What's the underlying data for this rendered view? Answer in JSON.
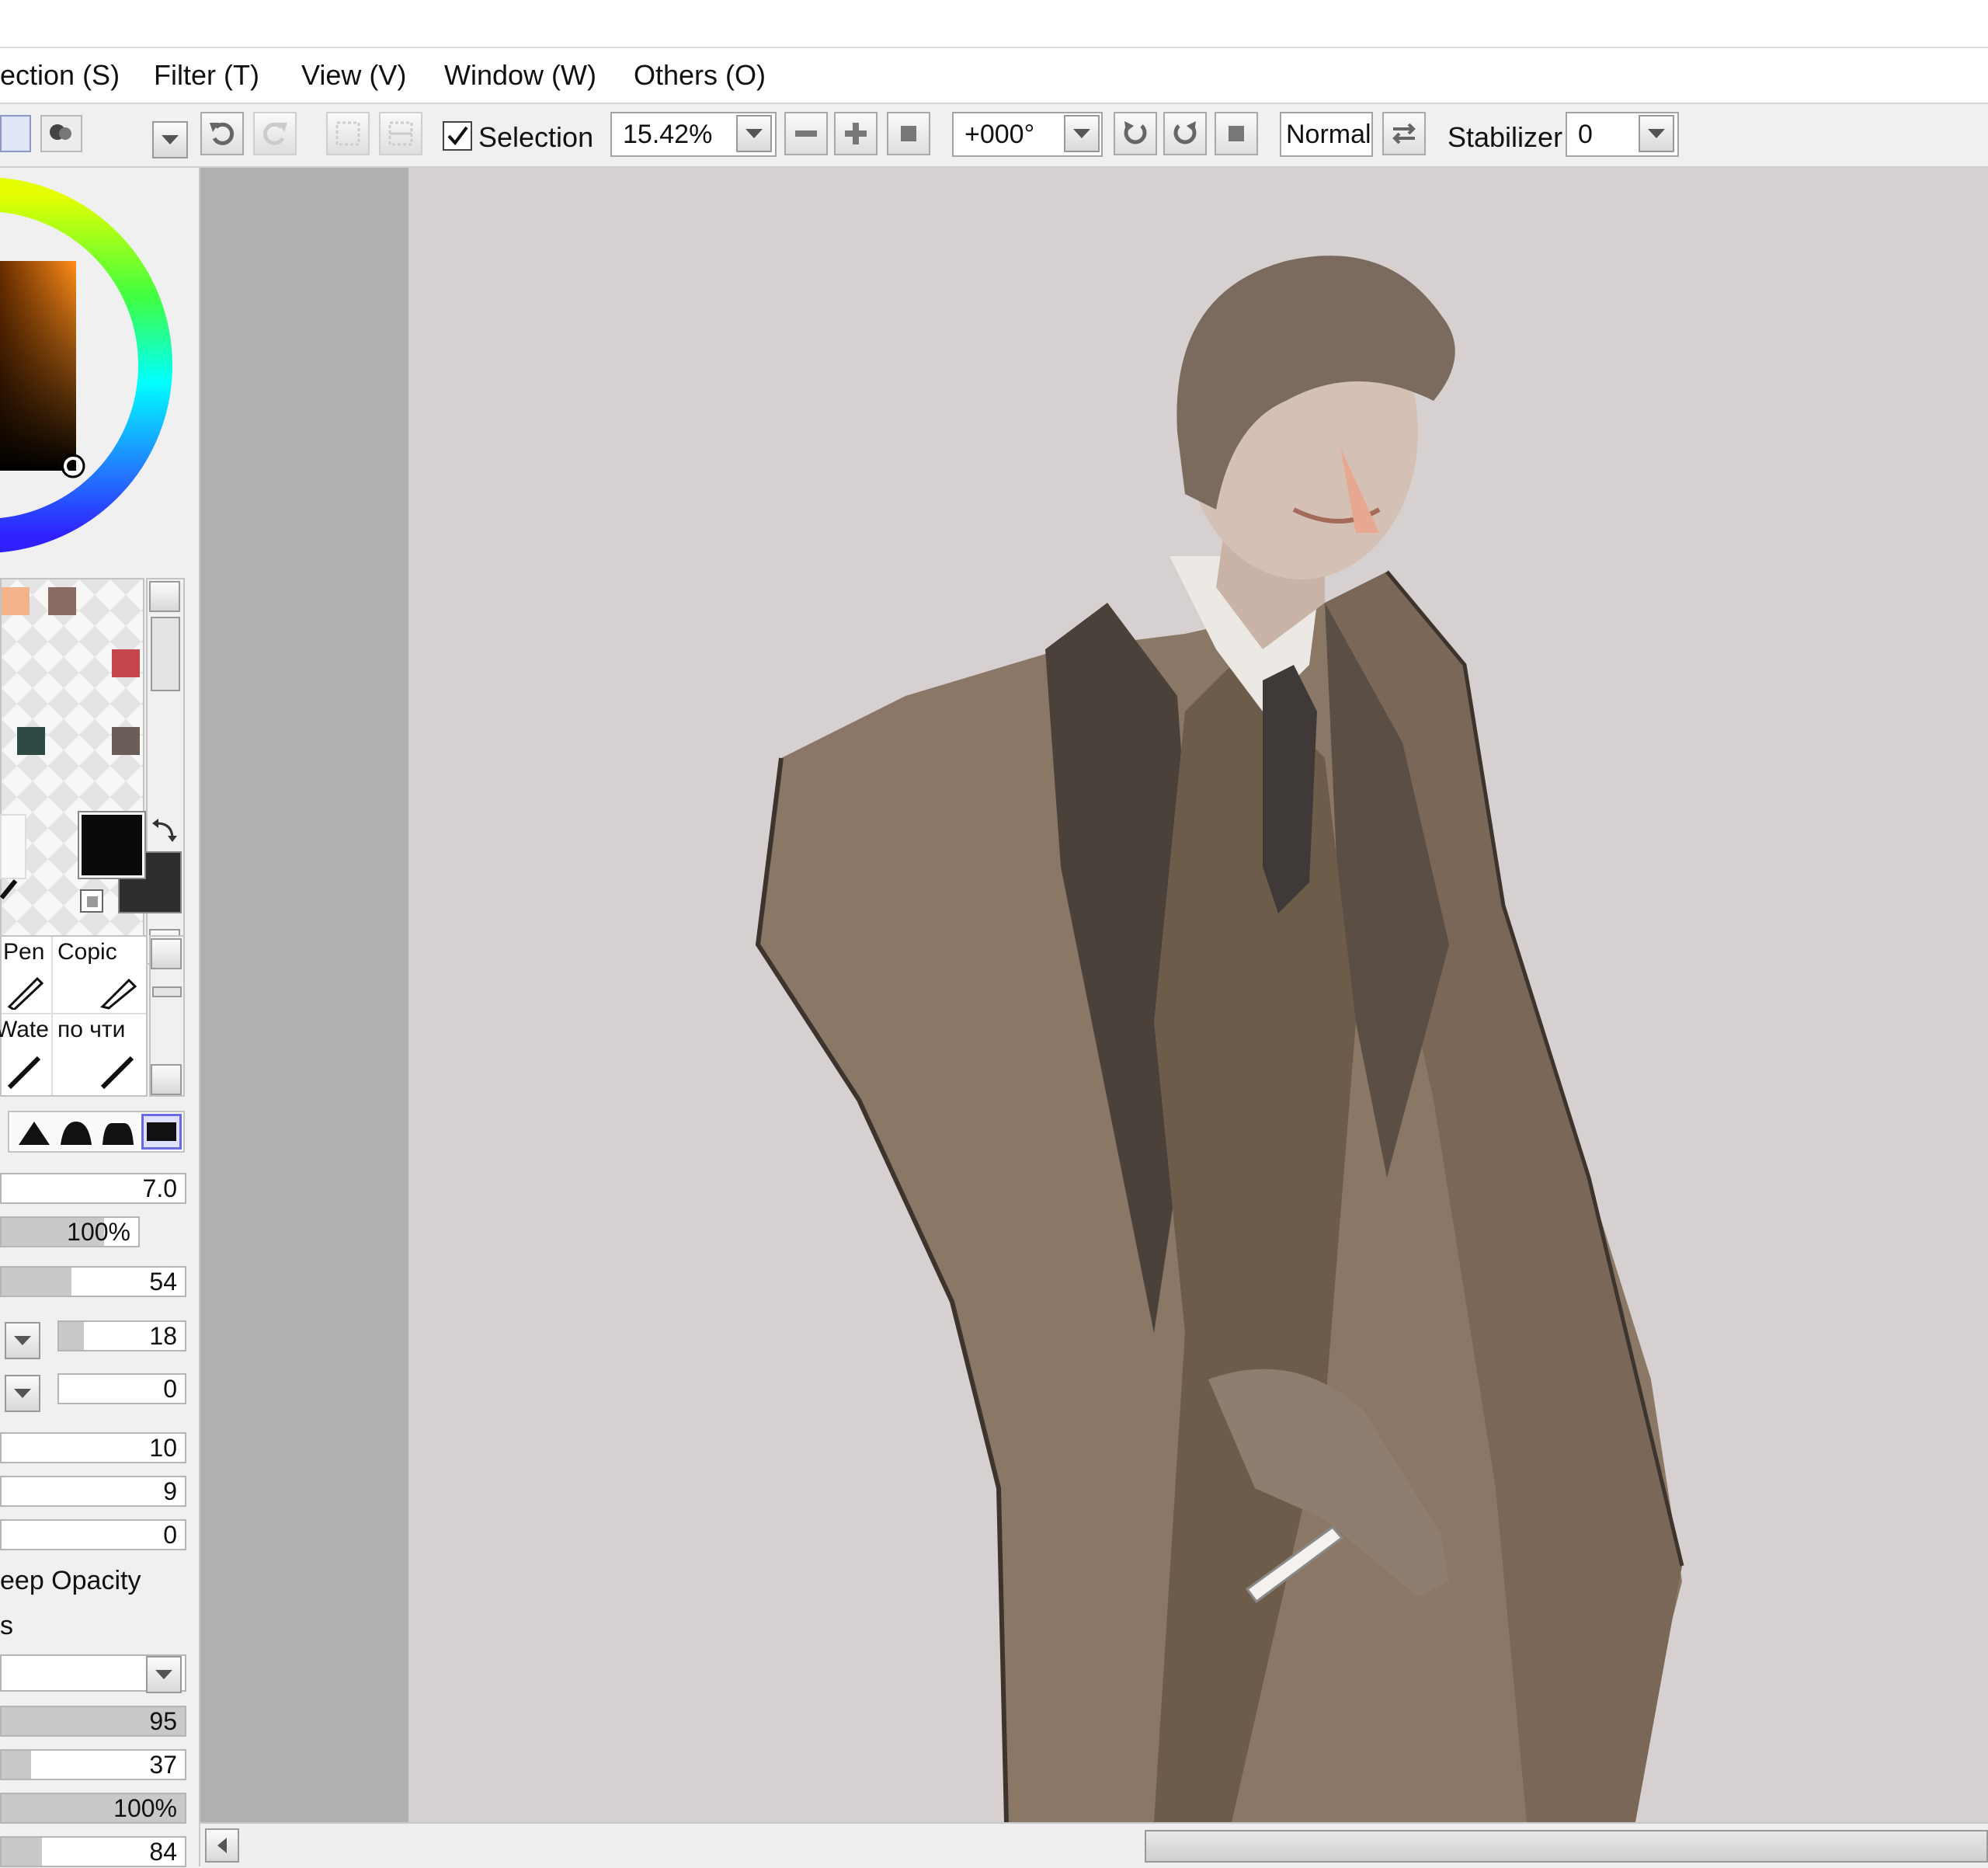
{
  "menu": [
    {
      "label": "ection (S)"
    },
    {
      "label": "Filter (T)"
    },
    {
      "label": "View (V)"
    },
    {
      "label": "Window (W)"
    },
    {
      "label": "Others (O)"
    }
  ],
  "toolbar": {
    "selection_label": "Selection",
    "selection_checked": true,
    "zoom_value": "15.42%",
    "rotation_value": "+000°",
    "blend_mode": "Normal",
    "stabilizer_label": "Stabilizer",
    "stabilizer_value": "0"
  },
  "colors": {
    "foreground": "#0a0a0a",
    "background": "#2e2e2e",
    "swatches": [
      "#f4b48a",
      "#8a6b63",
      "#c4454a",
      "#2f4a44",
      "#6b5e58"
    ]
  },
  "brushes": [
    {
      "label": "Pen"
    },
    {
      "label": "Copic"
    },
    {
      "label": "Wate"
    },
    {
      "label": "по чти"
    }
  ],
  "brush_settings": {
    "size": "7.0",
    "min_size": "100%",
    "density": "54",
    "texture_strength": "18",
    "blend_value": "0",
    "v1": "10",
    "v2": "9",
    "v3": "0",
    "keep_opacity_label": "eep Opacity",
    "misc_label": "s",
    "blending": "95",
    "dilution": "37",
    "persistence": "100%",
    "last": "84"
  },
  "progress": {
    "density": 0.38,
    "texture": 0.2,
    "blending": 1.0,
    "dilution": 0.16,
    "persistence": 1.0,
    "last": 0.22,
    "min_size": 0.75
  }
}
